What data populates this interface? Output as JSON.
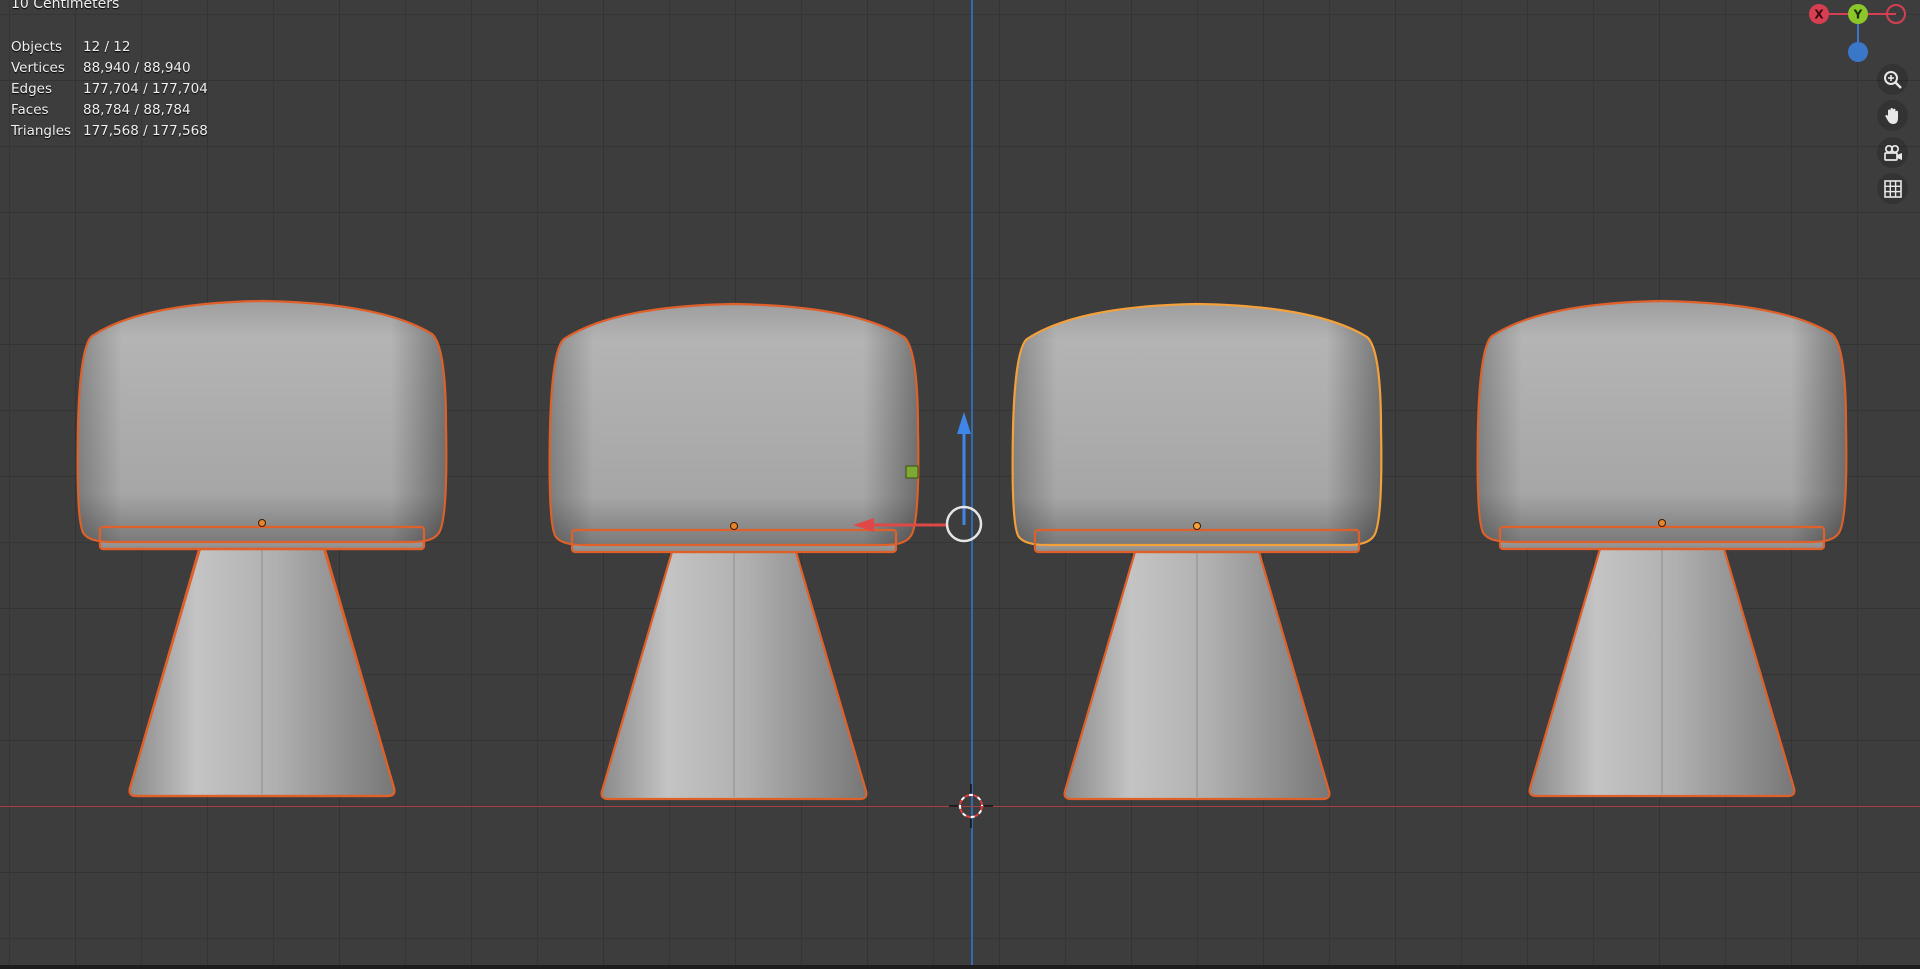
{
  "viewport": {
    "title_partial": "10 Centimeters"
  },
  "stats": [
    {
      "label": "Objects",
      "value": "12 / 12"
    },
    {
      "label": "Vertices",
      "value": "88,940 / 88,940"
    },
    {
      "label": "Edges",
      "value": "177,704 / 177,704"
    },
    {
      "label": "Faces",
      "value": "88,784 / 88,784"
    },
    {
      "label": "Triangles",
      "value": "177,568 / 177,568"
    }
  ],
  "nav_gizmo": {
    "x_label": "X",
    "y_label": "Y",
    "colors": {
      "x": "#d63e52",
      "y": "#8bc62a",
      "z": "#3a77c8"
    }
  },
  "view_buttons": [
    "zoom-icon",
    "hand-icon",
    "camera-icon",
    "grid-icon"
  ],
  "colors": {
    "background": "#3d3d3d",
    "selection_outline": "#e0602a",
    "active_outline": "#f5a13a"
  }
}
